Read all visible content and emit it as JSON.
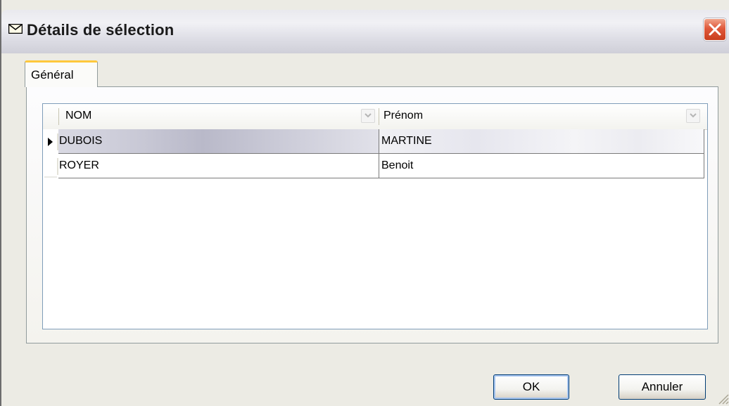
{
  "window": {
    "title": "Détails de sélection",
    "close_icon": "close-icon",
    "title_icon": "envelope-icon"
  },
  "tabs": [
    {
      "label": "Général",
      "selected": true
    }
  ],
  "grid": {
    "columns": [
      {
        "label": "NOM"
      },
      {
        "label": "Prénom"
      }
    ],
    "rows": [
      {
        "nom": "DUBOIS",
        "prenom": "MARTINE",
        "current": true
      },
      {
        "nom": "ROYER",
        "prenom": "Benoit",
        "current": false
      }
    ]
  },
  "buttons": {
    "ok_label": "OK",
    "cancel_label": "Annuler"
  },
  "colors": {
    "close_button": "#e0593b",
    "selected_tab_accent": "#ffc83c",
    "button_border": "#003c74"
  }
}
